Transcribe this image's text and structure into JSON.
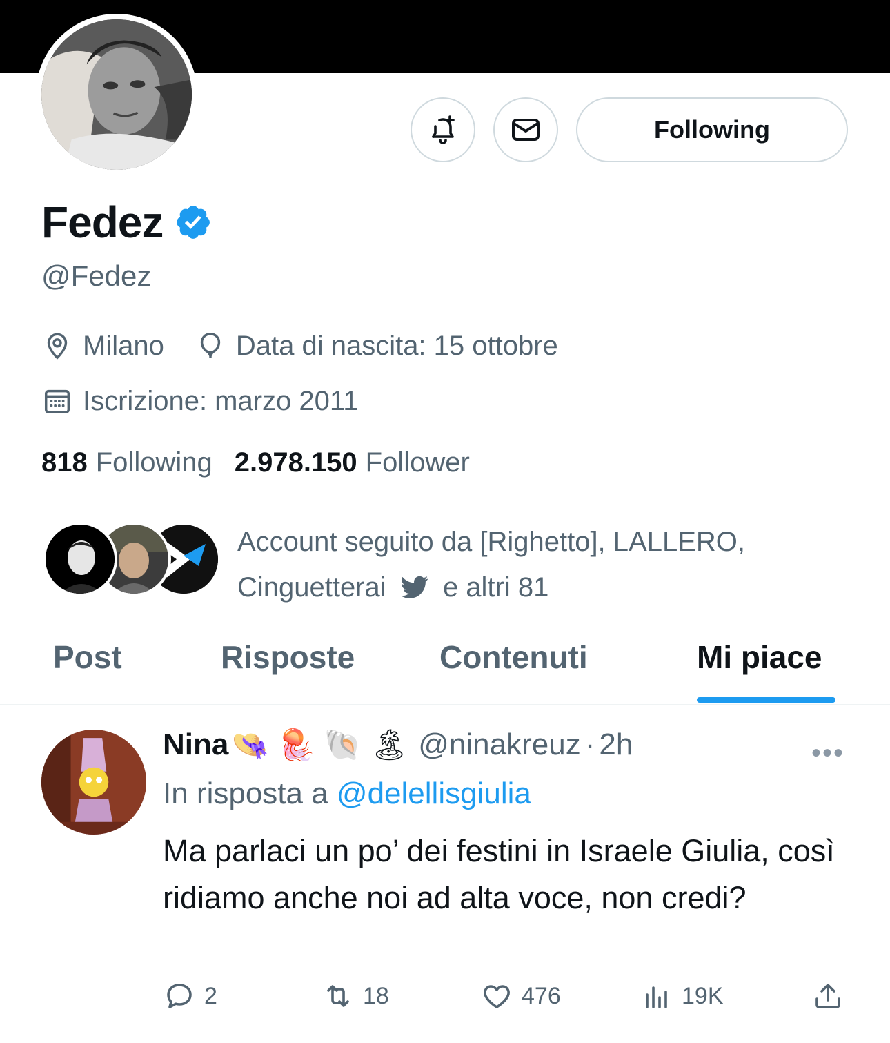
{
  "profile": {
    "name": "Fedez",
    "handle": "@Fedez",
    "location": "Milano",
    "birthday": "Data di nascita: 15 ottobre",
    "joined": "Iscrizione: marzo 2011",
    "following_count": "818",
    "following_label": "Following",
    "followers_count": "2.978.150",
    "followers_label": "Follower"
  },
  "actions": {
    "follow_button": "Following"
  },
  "known_followers": {
    "line1": "Account seguito da [Righetto], LALLERO,",
    "line2a": "Cinguetterai",
    "line2b": "e altri 81"
  },
  "tabs": [
    {
      "label": "Post"
    },
    {
      "label": "Risposte"
    },
    {
      "label": "Contenuti"
    },
    {
      "label": "Mi piace"
    }
  ],
  "tweet": {
    "author": "Nina",
    "emojis": "👒 🪼 🐚 🏝",
    "handle": "@ninakreuz",
    "dot": "·",
    "time": "2h",
    "reply_prefix": "In risposta a",
    "reply_mention": "@delellisgiulia",
    "text": "Ma parlaci un po’ dei festini in Israele Giulia, così ridiamo anche noi ad alta voce, non credi?",
    "replies": "2",
    "retweets": "18",
    "likes": "476",
    "views": "19K"
  },
  "colors": {
    "accent": "#1d9bf0",
    "secondary_text": "#536471",
    "primary_text": "#0f1419",
    "border": "#cfd9de"
  }
}
